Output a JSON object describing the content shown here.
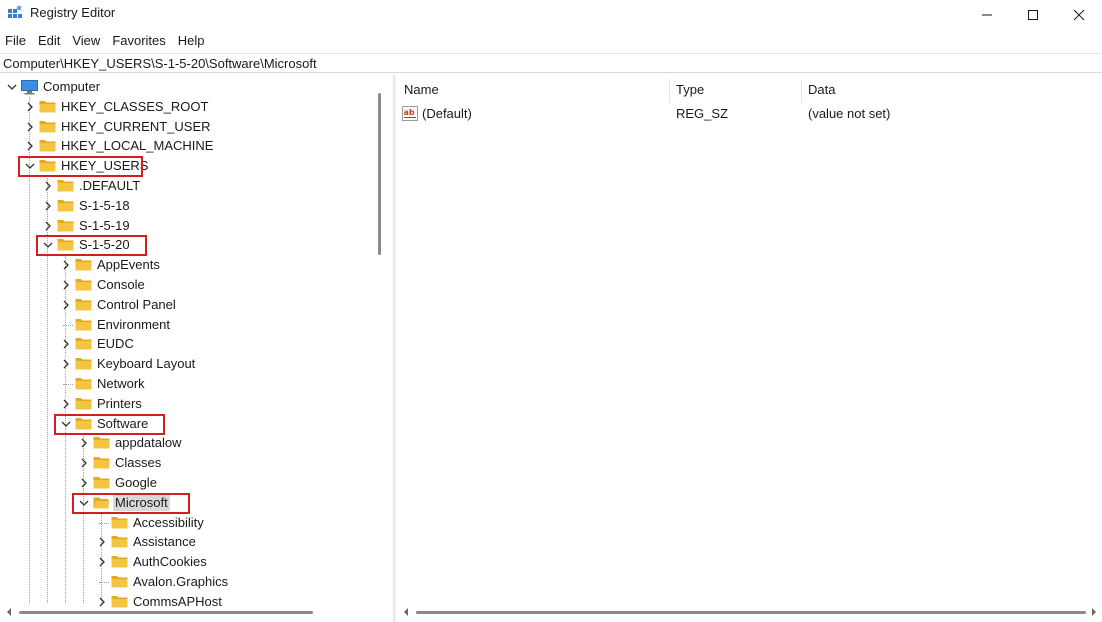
{
  "window": {
    "title": "Registry Editor",
    "icon": "registry-editor-icon"
  },
  "menu": {
    "items": [
      "File",
      "Edit",
      "View",
      "Favorites",
      "Help"
    ]
  },
  "address": {
    "path": "Computer\\HKEY_USERS\\S-1-5-20\\Software\\Microsoft"
  },
  "tree": {
    "rows": [
      {
        "label": "Computer",
        "level": 0,
        "chevron": "down",
        "icon": "computer-icon"
      },
      {
        "label": "HKEY_CLASSES_ROOT",
        "level": 1,
        "chevron": "right",
        "icon": "folder-icon"
      },
      {
        "label": "HKEY_CURRENT_USER",
        "level": 1,
        "chevron": "right",
        "icon": "folder-icon"
      },
      {
        "label": "HKEY_LOCAL_MACHINE",
        "level": 1,
        "chevron": "right",
        "icon": "folder-icon"
      },
      {
        "label": "HKEY_USERS",
        "level": 1,
        "chevron": "down",
        "icon": "folder-icon",
        "highlighted": true
      },
      {
        "label": ".DEFAULT",
        "level": 2,
        "chevron": "right",
        "icon": "folder-icon"
      },
      {
        "label": "S-1-5-18",
        "level": 2,
        "chevron": "right",
        "icon": "folder-icon"
      },
      {
        "label": "S-1-5-19",
        "level": 2,
        "chevron": "right",
        "icon": "folder-icon"
      },
      {
        "label": "S-1-5-20",
        "level": 2,
        "chevron": "down",
        "icon": "folder-icon",
        "highlighted": true
      },
      {
        "label": "AppEvents",
        "level": 3,
        "chevron": "right",
        "icon": "folder-icon"
      },
      {
        "label": "Console",
        "level": 3,
        "chevron": "right",
        "icon": "folder-icon"
      },
      {
        "label": "Control Panel",
        "level": 3,
        "chevron": "right",
        "icon": "folder-icon"
      },
      {
        "label": "Environment",
        "level": 3,
        "chevron": "none",
        "icon": "folder-icon"
      },
      {
        "label": "EUDC",
        "level": 3,
        "chevron": "right",
        "icon": "folder-icon"
      },
      {
        "label": "Keyboard Layout",
        "level": 3,
        "chevron": "right",
        "icon": "folder-icon"
      },
      {
        "label": "Network",
        "level": 3,
        "chevron": "none",
        "icon": "folder-icon"
      },
      {
        "label": "Printers",
        "level": 3,
        "chevron": "right",
        "icon": "folder-icon"
      },
      {
        "label": "Software",
        "level": 3,
        "chevron": "down",
        "icon": "folder-icon",
        "highlighted": true
      },
      {
        "label": "appdatalow",
        "level": 4,
        "chevron": "right",
        "icon": "folder-icon"
      },
      {
        "label": "Classes",
        "level": 4,
        "chevron": "right",
        "icon": "folder-icon"
      },
      {
        "label": "Google",
        "level": 4,
        "chevron": "right",
        "icon": "folder-icon"
      },
      {
        "label": "Microsoft",
        "level": 4,
        "chevron": "down",
        "icon": "open-folder-icon",
        "highlighted": true,
        "selected": true
      },
      {
        "label": "Accessibility",
        "level": 5,
        "chevron": "none",
        "icon": "folder-icon"
      },
      {
        "label": "Assistance",
        "level": 5,
        "chevron": "right",
        "icon": "folder-icon"
      },
      {
        "label": "AuthCookies",
        "level": 5,
        "chevron": "right",
        "icon": "folder-icon"
      },
      {
        "label": "Avalon.Graphics",
        "level": 5,
        "chevron": "none",
        "icon": "folder-icon"
      },
      {
        "label": "CommsAPHost",
        "level": 5,
        "chevron": "right",
        "icon": "folder-icon"
      }
    ]
  },
  "list": {
    "columns": [
      "Name",
      "Type",
      "Data"
    ],
    "rows": [
      {
        "name": "(Default)",
        "type": "REG_SZ",
        "data": "(value not set)",
        "icon": "string-value-icon"
      }
    ]
  },
  "colors": {
    "highlight_border": "#d21f1f",
    "folder": "#f5c542",
    "selected_row": "#d9d9d9"
  }
}
